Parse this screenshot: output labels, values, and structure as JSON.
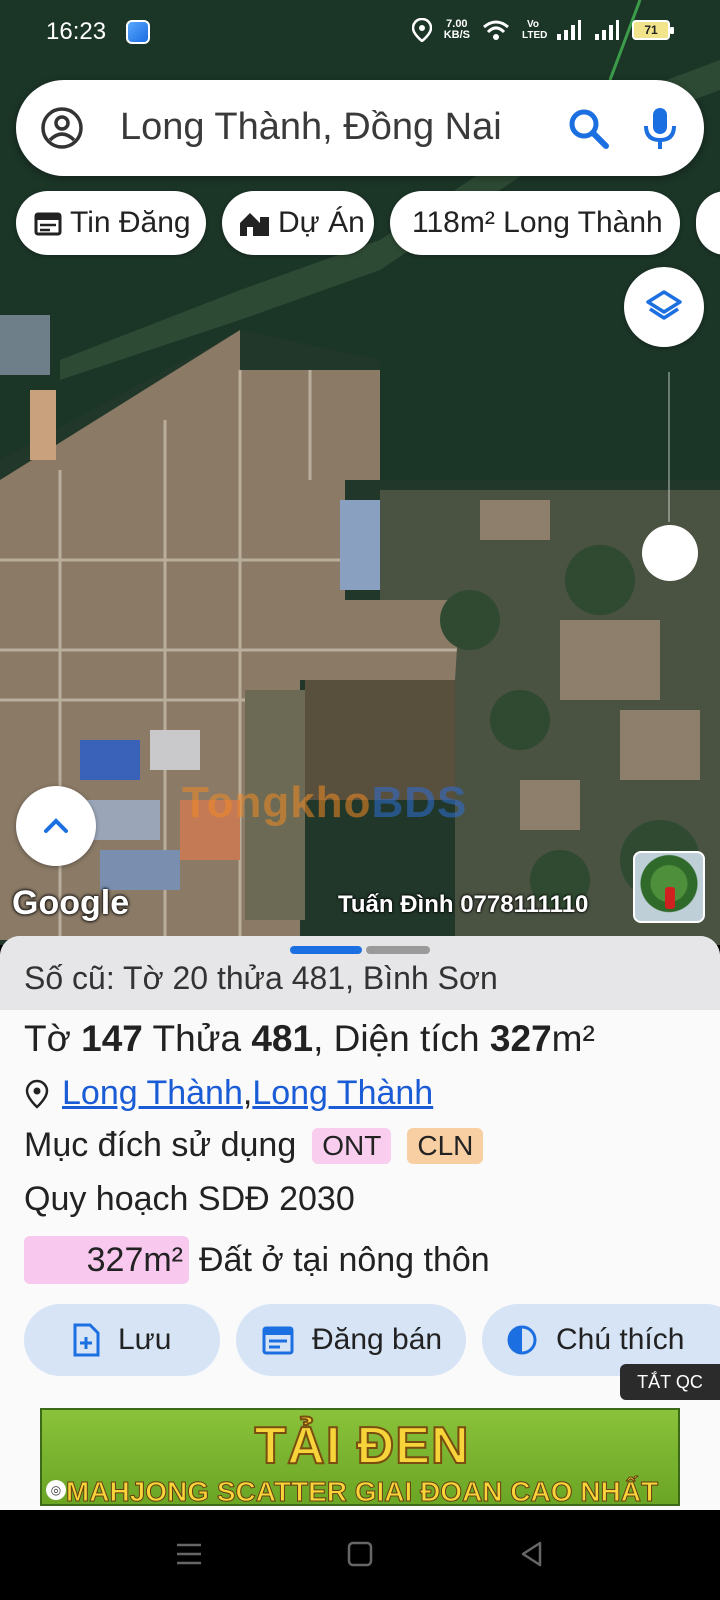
{
  "status_bar": {
    "time": "16:23",
    "net_speed_value": "7.00",
    "net_speed_unit": "KB/S",
    "network_label": "Vo LTED",
    "battery": "71"
  },
  "search": {
    "query": "Long Thành, Đồng Nai"
  },
  "chips": [
    {
      "label": "Tin Đăng",
      "icon": "calendar-icon"
    },
    {
      "label": "Dự Án",
      "icon": "building-icon"
    },
    {
      "label": "118m² Long Thành",
      "icon": ""
    }
  ],
  "map": {
    "watermark_a": "Tongkho",
    "watermark_b": "BDS",
    "google_label": "Google",
    "author_credit": "Tuấn Đình 0778111110"
  },
  "sheet": {
    "old_parcel": "Số cũ: Tờ 20 thửa 481, Bình Sơn",
    "parcel": {
      "sheet_label": "Tờ",
      "sheet_no": "147",
      "lot_label": "Thửa",
      "lot_no": "481",
      "area_label": ", Diện tích",
      "area_value": "327",
      "area_unit": "m²"
    },
    "location": {
      "district": "Long Thành",
      "separator": ", ",
      "ward": "Long Thành"
    },
    "usage": {
      "label": "Mục đích sử dụng",
      "tags": [
        "ONT",
        "CLN"
      ]
    },
    "plan_label": "Quy hoạch SDĐ 2030",
    "plan_area": "327m²",
    "plan_desc": "Đất ở tại nông thôn",
    "actions": [
      {
        "label": "Lưu",
        "icon": "save-icon"
      },
      {
        "label": "Đăng bán",
        "icon": "post-icon"
      },
      {
        "label": "Chú thích",
        "icon": "contrast-icon"
      }
    ],
    "ad_toggle": "TẮT QC"
  },
  "ad": {
    "title": "TẢI ĐEN",
    "subtitle": "MAHJONG SCATTER GIAI ĐOAN CAO NHẤT"
  },
  "colors": {
    "accent": "#1c6fe0",
    "link": "#1a5bd6",
    "tag_ont": "#f8cdee",
    "tag_cln": "#f8cfa2",
    "button_bg": "#d6e4f6"
  }
}
